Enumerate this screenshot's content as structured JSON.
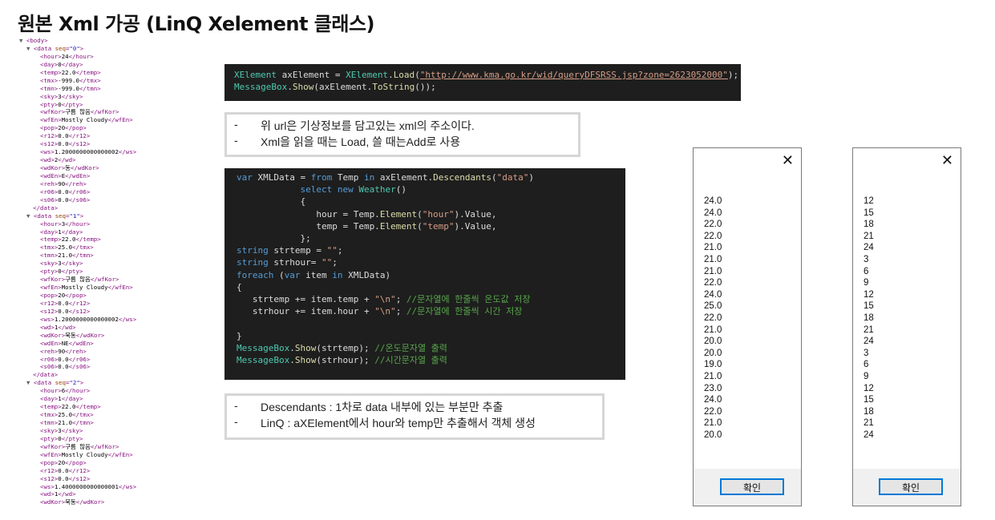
{
  "title": "원본 Xml 가공 (LinQ Xelement 클래스)",
  "xml_tree": [
    {
      "t": "open",
      "indent": 0,
      "toggle": "▼",
      "tag": "body"
    },
    {
      "t": "open",
      "indent": 1,
      "toggle": "▼",
      "tag": "data",
      "attr": "seq",
      "val": "0"
    },
    {
      "t": "leaf",
      "indent": 2,
      "tag": "hour",
      "text": "24"
    },
    {
      "t": "leaf",
      "indent": 2,
      "tag": "day",
      "text": "0"
    },
    {
      "t": "leaf",
      "indent": 2,
      "tag": "temp",
      "text": "22.0"
    },
    {
      "t": "leaf",
      "indent": 2,
      "tag": "tmx",
      "text": "-999.0"
    },
    {
      "t": "leaf",
      "indent": 2,
      "tag": "tmn",
      "text": "-999.0"
    },
    {
      "t": "leaf",
      "indent": 2,
      "tag": "sky",
      "text": "3"
    },
    {
      "t": "leaf",
      "indent": 2,
      "tag": "pty",
      "text": "0"
    },
    {
      "t": "leaf",
      "indent": 2,
      "tag": "wfKor",
      "text": "구름 많음"
    },
    {
      "t": "leaf",
      "indent": 2,
      "tag": "wfEn",
      "text": "Mostly Cloudy"
    },
    {
      "t": "leaf",
      "indent": 2,
      "tag": "pop",
      "text": "20"
    },
    {
      "t": "leaf",
      "indent": 2,
      "tag": "r12",
      "text": "0.0"
    },
    {
      "t": "leaf",
      "indent": 2,
      "tag": "s12",
      "text": "0.0"
    },
    {
      "t": "leaf",
      "indent": 2,
      "tag": "ws",
      "text": "1.2000000000000002"
    },
    {
      "t": "leaf",
      "indent": 2,
      "tag": "wd",
      "text": "2"
    },
    {
      "t": "leaf",
      "indent": 2,
      "tag": "wdKor",
      "text": "동"
    },
    {
      "t": "leaf",
      "indent": 2,
      "tag": "wdEn",
      "text": "E"
    },
    {
      "t": "leaf",
      "indent": 2,
      "tag": "reh",
      "text": "90"
    },
    {
      "t": "leaf",
      "indent": 2,
      "tag": "r06",
      "text": "0.0"
    },
    {
      "t": "leaf",
      "indent": 2,
      "tag": "s06",
      "text": "0.0"
    },
    {
      "t": "close",
      "indent": 1,
      "tag": "data"
    },
    {
      "t": "open",
      "indent": 1,
      "toggle": "▼",
      "tag": "data",
      "attr": "seq",
      "val": "1"
    },
    {
      "t": "leaf",
      "indent": 2,
      "tag": "hour",
      "text": "3"
    },
    {
      "t": "leaf",
      "indent": 2,
      "tag": "day",
      "text": "1"
    },
    {
      "t": "leaf",
      "indent": 2,
      "tag": "temp",
      "text": "22.0"
    },
    {
      "t": "leaf",
      "indent": 2,
      "tag": "tmx",
      "text": "25.0"
    },
    {
      "t": "leaf",
      "indent": 2,
      "tag": "tmn",
      "text": "21.0"
    },
    {
      "t": "leaf",
      "indent": 2,
      "tag": "sky",
      "text": "3"
    },
    {
      "t": "leaf",
      "indent": 2,
      "tag": "pty",
      "text": "0"
    },
    {
      "t": "leaf",
      "indent": 2,
      "tag": "wfKor",
      "text": "구름 많음"
    },
    {
      "t": "leaf",
      "indent": 2,
      "tag": "wfEn",
      "text": "Mostly Cloudy"
    },
    {
      "t": "leaf",
      "indent": 2,
      "tag": "pop",
      "text": "20"
    },
    {
      "t": "leaf",
      "indent": 2,
      "tag": "r12",
      "text": "0.0"
    },
    {
      "t": "leaf",
      "indent": 2,
      "tag": "s12",
      "text": "0.0"
    },
    {
      "t": "leaf",
      "indent": 2,
      "tag": "ws",
      "text": "1.2000000000000002"
    },
    {
      "t": "leaf",
      "indent": 2,
      "tag": "wd",
      "text": "1"
    },
    {
      "t": "leaf",
      "indent": 2,
      "tag": "wdKor",
      "text": "북동"
    },
    {
      "t": "leaf",
      "indent": 2,
      "tag": "wdEn",
      "text": "NE"
    },
    {
      "t": "leaf",
      "indent": 2,
      "tag": "reh",
      "text": "90"
    },
    {
      "t": "leaf",
      "indent": 2,
      "tag": "r06",
      "text": "0.0"
    },
    {
      "t": "leaf",
      "indent": 2,
      "tag": "s06",
      "text": "0.0"
    },
    {
      "t": "close",
      "indent": 1,
      "tag": "data"
    },
    {
      "t": "open",
      "indent": 1,
      "toggle": "▼",
      "tag": "data",
      "attr": "seq",
      "val": "2"
    },
    {
      "t": "leaf",
      "indent": 2,
      "tag": "hour",
      "text": "6"
    },
    {
      "t": "leaf",
      "indent": 2,
      "tag": "day",
      "text": "1"
    },
    {
      "t": "leaf",
      "indent": 2,
      "tag": "temp",
      "text": "22.0"
    },
    {
      "t": "leaf",
      "indent": 2,
      "tag": "tmx",
      "text": "25.0"
    },
    {
      "t": "leaf",
      "indent": 2,
      "tag": "tmn",
      "text": "21.0"
    },
    {
      "t": "leaf",
      "indent": 2,
      "tag": "sky",
      "text": "3"
    },
    {
      "t": "leaf",
      "indent": 2,
      "tag": "pty",
      "text": "0"
    },
    {
      "t": "leaf",
      "indent": 2,
      "tag": "wfKor",
      "text": "구름 많음"
    },
    {
      "t": "leaf",
      "indent": 2,
      "tag": "wfEn",
      "text": "Mostly Cloudy"
    },
    {
      "t": "leaf",
      "indent": 2,
      "tag": "pop",
      "text": "20"
    },
    {
      "t": "leaf",
      "indent": 2,
      "tag": "r12",
      "text": "0.0"
    },
    {
      "t": "leaf",
      "indent": 2,
      "tag": "s12",
      "text": "0.0"
    },
    {
      "t": "leaf",
      "indent": 2,
      "tag": "ws",
      "text": "1.4000000000000001"
    },
    {
      "t": "leaf",
      "indent": 2,
      "tag": "wd",
      "text": "1"
    },
    {
      "t": "leaf",
      "indent": 2,
      "tag": "wdKor",
      "text": "북동"
    }
  ],
  "code1": [
    [
      [
        "ty",
        "XElement"
      ],
      [
        "vr",
        " axElement = "
      ],
      [
        "ty",
        "XElement"
      ],
      [
        "vr",
        "."
      ],
      [
        "fn",
        "Load"
      ],
      [
        "vr",
        "("
      ],
      [
        "lk",
        "\"http://www.kma.go.kr/wid/queryDFSRSS.jsp?zone=2623052000\""
      ],
      [
        "vr",
        ");"
      ]
    ],
    [
      [
        "ty",
        "MessageBox"
      ],
      [
        "vr",
        "."
      ],
      [
        "fn",
        "Show"
      ],
      [
        "vr",
        "(axElement."
      ],
      [
        "fn",
        "ToString"
      ],
      [
        "vr",
        "());"
      ]
    ]
  ],
  "note1": [
    "위 url은 기상정보를 담고있는 xml의 주소이다.",
    "Xml을 읽을 때는 Load, 쓸 때는Add로 사용"
  ],
  "code2": [
    [
      [
        "kw",
        "var"
      ],
      [
        "vr",
        " XMLData = "
      ],
      [
        "kw",
        "from"
      ],
      [
        "vr",
        " Temp "
      ],
      [
        "kw",
        "in"
      ],
      [
        "vr",
        " axElement."
      ],
      [
        "fn",
        "Descendants"
      ],
      [
        "vr",
        "("
      ],
      [
        "st",
        "\"data\""
      ],
      [
        "vr",
        ")"
      ]
    ],
    [
      [
        "vr",
        "            "
      ],
      [
        "kw",
        "select new"
      ],
      [
        "vr",
        " "
      ],
      [
        "ty",
        "Weather"
      ],
      [
        "vr",
        "()"
      ]
    ],
    [
      [
        "vr",
        "            {"
      ]
    ],
    [
      [
        "vr",
        "               hour = Temp."
      ],
      [
        "fn",
        "Element"
      ],
      [
        "vr",
        "("
      ],
      [
        "st",
        "\"hour\""
      ],
      [
        "vr",
        ").Value,"
      ]
    ],
    [
      [
        "vr",
        "               temp = Temp."
      ],
      [
        "fn",
        "Element"
      ],
      [
        "vr",
        "("
      ],
      [
        "st",
        "\"temp\""
      ],
      [
        "vr",
        ").Value,"
      ]
    ],
    [
      [
        "vr",
        "            };"
      ]
    ],
    [
      [
        "kw",
        "string"
      ],
      [
        "vr",
        " strtemp = "
      ],
      [
        "st",
        "\"\""
      ],
      [
        "vr",
        ";"
      ]
    ],
    [
      [
        "kw",
        "string"
      ],
      [
        "vr",
        " strhour= "
      ],
      [
        "st",
        "\"\""
      ],
      [
        "vr",
        ";"
      ]
    ],
    [
      [
        "kw",
        "foreach"
      ],
      [
        "vr",
        " ("
      ],
      [
        "kw",
        "var"
      ],
      [
        "vr",
        " item "
      ],
      [
        "kw",
        "in"
      ],
      [
        "vr",
        " XMLData)"
      ]
    ],
    [
      [
        "vr",
        "{"
      ]
    ],
    [
      [
        "vr",
        "   strtemp += item.temp + "
      ],
      [
        "st",
        "\"\\n\""
      ],
      [
        "vr",
        "; "
      ],
      [
        "cm",
        "//문자열에 한줄씩 온도값 저장"
      ]
    ],
    [
      [
        "vr",
        "   strhour += item.hour + "
      ],
      [
        "st",
        "\"\\n\""
      ],
      [
        "vr",
        "; "
      ],
      [
        "cm",
        "//문자열에 한줄씩 시간 저장"
      ]
    ],
    [
      [
        "vr",
        ""
      ]
    ],
    [
      [
        "vr",
        "}"
      ]
    ],
    [
      [
        "ty",
        "MessageBox"
      ],
      [
        "vr",
        "."
      ],
      [
        "fn",
        "Show"
      ],
      [
        "vr",
        "(strtemp); "
      ],
      [
        "cm",
        "//온도문자열 출력"
      ]
    ],
    [
      [
        "ty",
        "MessageBox"
      ],
      [
        "vr",
        "."
      ],
      [
        "fn",
        "Show"
      ],
      [
        "vr",
        "(strhour); "
      ],
      [
        "cm",
        "//시간문자열 출력"
      ]
    ]
  ],
  "note2": [
    "Descendants : 1차로 data 내부에 있는 부분만 추출",
    "LinQ : aXElement에서 hour와 temp만 추출해서 객체 생성"
  ],
  "msgbox_temp": {
    "close": "✕",
    "ok_label": "확인",
    "values": [
      "24.0",
      "24.0",
      "22.0",
      "22.0",
      "21.0",
      "21.0",
      "21.0",
      "22.0",
      "24.0",
      "25.0",
      "22.0",
      "21.0",
      "20.0",
      "20.0",
      "19.0",
      "21.0",
      "23.0",
      "24.0",
      "22.0",
      "21.0",
      "20.0"
    ]
  },
  "msgbox_hour": {
    "close": "✕",
    "ok_label": "확인",
    "values": [
      "12",
      "15",
      "18",
      "21",
      "24",
      "3",
      "6",
      "9",
      "12",
      "15",
      "18",
      "21",
      "24",
      "3",
      "6",
      "9",
      "12",
      "15",
      "18",
      "21",
      "24"
    ]
  },
  "colors": {
    "code_bg": "#1e1e1e",
    "note_border": "#d6d6d6",
    "ok_border": "#0078d7",
    "xml_tag": "#881280"
  }
}
